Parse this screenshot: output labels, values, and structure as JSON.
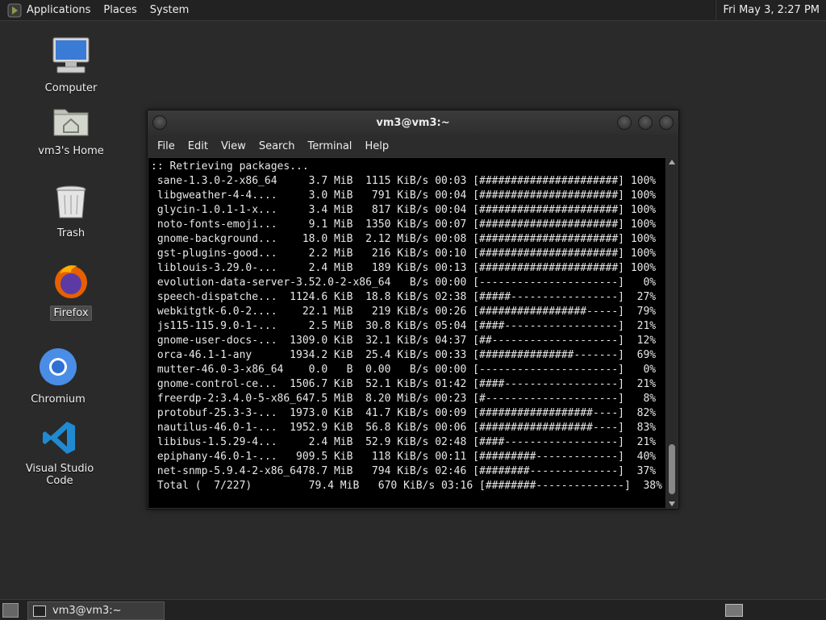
{
  "top_panel": {
    "menus": [
      "Applications",
      "Places",
      "System"
    ],
    "clock": "Fri May  3,  2:27 PM"
  },
  "desktop_icons": [
    {
      "label": "Computer",
      "icon": "computer-icon"
    },
    {
      "label": "vm3's Home",
      "icon": "home-folder-icon"
    },
    {
      "label": "Trash",
      "icon": "trash-icon"
    },
    {
      "label": "Firefox",
      "icon": "firefox-icon",
      "selected": true
    },
    {
      "label": "Chromium",
      "icon": "chromium-icon"
    },
    {
      "label": "Visual Studio Code",
      "icon": "vscode-icon"
    }
  ],
  "terminal": {
    "title": "vm3@vm3:~",
    "menu": [
      "File",
      "Edit",
      "View",
      "Search",
      "Terminal",
      "Help"
    ],
    "lines": [
      ":: Retrieving packages...",
      " sane-1.3.0-2-x86_64     3.7 MiB  1115 KiB/s 00:03 [######################] 100%",
      " libgweather-4-4....     3.0 MiB   791 KiB/s 00:04 [######################] 100%",
      " glycin-1.0.1-1-x...     3.4 MiB   817 KiB/s 00:04 [######################] 100%",
      " noto-fonts-emoji...     9.1 MiB  1350 KiB/s 00:07 [######################] 100%",
      " gnome-background...    18.0 MiB  2.12 MiB/s 00:08 [######################] 100%",
      " gst-plugins-good...     2.2 MiB   216 KiB/s 00:10 [######################] 100%",
      " liblouis-3.29.0-...     2.4 MiB   189 KiB/s 00:13 [######################] 100%",
      " evolution-data-server-3.52.0-2-x86_64   B/s 00:00 [----------------------]   0%",
      " speech-dispatche...  1124.6 KiB  18.8 KiB/s 02:38 [#####-----------------]  27%",
      " webkitgtk-6.0-2....    22.1 MiB   219 KiB/s 00:26 [#################-----]  79%",
      " js115-115.9.0-1-...     2.5 MiB  30.8 KiB/s 05:04 [####------------------]  21%",
      " gnome-user-docs-...  1309.0 KiB  32.1 KiB/s 04:37 [##--------------------]  12%",
      " orca-46.1-1-any      1934.2 KiB  25.4 KiB/s 00:33 [###############-------]  69%",
      " mutter-46.0-3-x86_64    0.0   B  0.00   B/s 00:00 [----------------------]   0%",
      " gnome-control-ce...  1506.7 KiB  52.1 KiB/s 01:42 [####------------------]  21%",
      " freerdp-2:3.4.0-5-x86_647.5 MiB  8.20 MiB/s 00:23 [#---------------------]   8%",
      " protobuf-25.3-3-...  1973.0 KiB  41.7 KiB/s 00:09 [##################----]  82%",
      " nautilus-46.0-1-...  1952.9 KiB  56.8 KiB/s 00:06 [##################----]  83%",
      " libibus-1.5.29-4...     2.4 MiB  52.9 KiB/s 02:48 [####------------------]  21%",
      " epiphany-46.0-1-...   909.5 KiB   118 KiB/s 00:11 [#########-------------]  40%",
      " net-snmp-5.9.4-2-x86_6478.7 MiB   794 KiB/s 02:46 [########--------------]  37%",
      " Total (  7/227)         79.4 MiB   670 KiB/s 03:16 [########--------------]  38%"
    ]
  },
  "taskbar": {
    "window_button": "vm3@vm3:~"
  }
}
